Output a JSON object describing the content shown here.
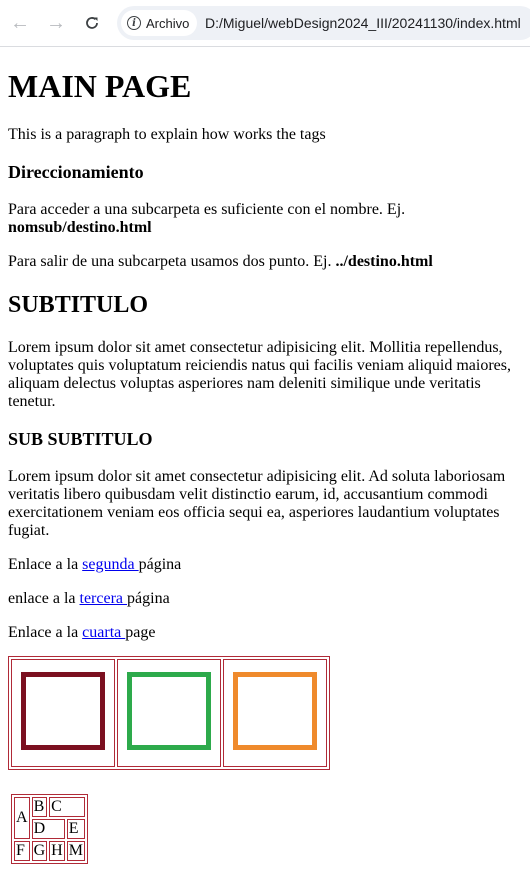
{
  "browser": {
    "back_icon": "arrow-left-icon",
    "forward_icon": "arrow-right-icon",
    "reload_icon": "reload-icon",
    "site_info_label": "Archivo",
    "url": "D:/Miguel/webDesign2024_III/20241130/index.html"
  },
  "page": {
    "title": "MAIN PAGE",
    "intro": "This is a paragraph to explain how works the tags",
    "routing_heading": "Direccionamiento",
    "routing_p1_text": "Para acceder a una subcarpeta es suficiente con el nombre. Ej.",
    "routing_p1_code": "nomsub/destino.html",
    "routing_p2_text": "Para salir de una subcarpeta usamos dos punto. Ej.",
    "routing_p2_code": "../destino.html",
    "subtitle": "SUBTITULO",
    "lorem1": "Lorem ipsum dolor sit amet consectetur adipisicing elit. Mollitia repellendus, voluptates quis voluptatum reiciendis natus qui facilis veniam aliquid maiores, aliquam delectus voluptas asperiores nam deleniti similique unde veritatis tenetur.",
    "subsubtitle": "SUB SUBTITULO",
    "lorem2": "Lorem ipsum dolor sit amet consectetur adipisicing elit. Ad soluta laboriosam veritatis libero quibusdam velit distinctio earum, id, accusantium commodi exercitationem veniam eos officia sequi ea, asperiores laudantium voluptates fugiat.",
    "links": [
      {
        "before": "Enlace a la ",
        "link": "segunda ",
        "after": "página"
      },
      {
        "before": "enlace a la ",
        "link": "tercera ",
        "after": "página"
      },
      {
        "before": "Enlace a la ",
        "link": "cuarta ",
        "after": "page"
      }
    ],
    "box_colors": [
      "#7b1020",
      "#2daa4b",
      "#ef8a2c"
    ],
    "letters": {
      "a": "A",
      "b": "B",
      "c": "C",
      "d": "D",
      "e": "E",
      "f": "F",
      "g": "G",
      "h": "H",
      "m": "M"
    }
  }
}
